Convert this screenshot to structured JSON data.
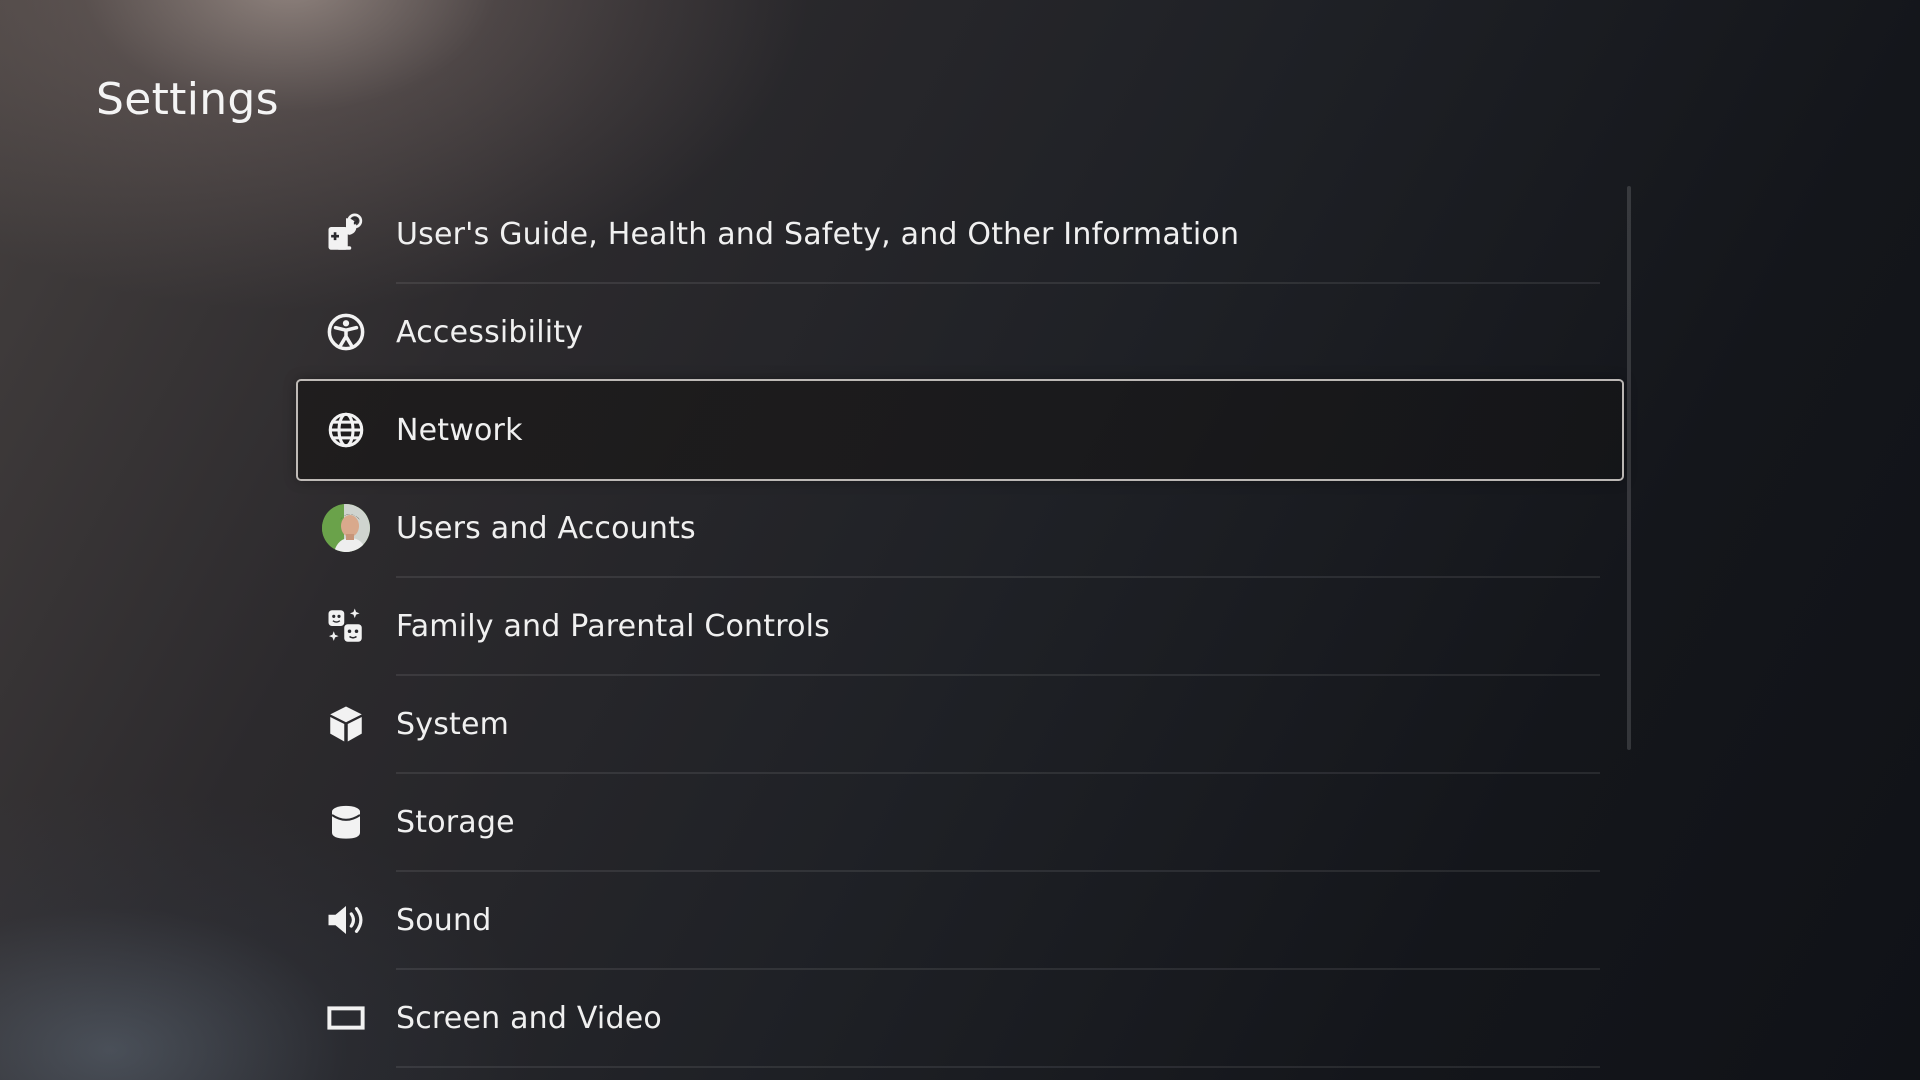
{
  "page": {
    "title": "Settings"
  },
  "menu": {
    "items": [
      {
        "label": "User's Guide, Health and Safety, and Other Information",
        "icon": "users-guide-icon"
      },
      {
        "label": "Accessibility",
        "icon": "accessibility-icon"
      },
      {
        "label": "Network",
        "icon": "globe-icon",
        "selected": true
      },
      {
        "label": "Users and Accounts",
        "icon": "user-avatar"
      },
      {
        "label": "Family and Parental Controls",
        "icon": "family-controls-icon"
      },
      {
        "label": "System",
        "icon": "cube-icon"
      },
      {
        "label": "Storage",
        "icon": "storage-icon"
      },
      {
        "label": "Sound",
        "icon": "speaker-icon"
      },
      {
        "label": "Screen and Video",
        "icon": "screen-icon"
      }
    ]
  },
  "colors": {
    "text": "#f0f0f0",
    "selection_border": "#e1dcd7",
    "background_dark": "#14161b"
  }
}
